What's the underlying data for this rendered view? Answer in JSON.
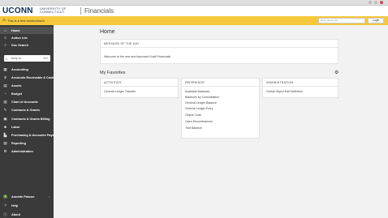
{
  "header": {
    "logo": "UCONN",
    "university": "UNIVERSITY OF CONNECTICUT",
    "app_title": "Financials"
  },
  "banner": {
    "message": "This is a test environment",
    "search_placeholder": "Basic (Enter ID)",
    "login_label": "Login"
  },
  "sidebar": {
    "top_items": [
      {
        "label": "Home",
        "icon": "home-icon"
      },
      {
        "label": "Action List",
        "icon": "list-icon"
      },
      {
        "label": "Doc Search",
        "icon": "search-icon"
      }
    ],
    "jump": {
      "label": "Jump to...",
      "go": "GO"
    },
    "items": [
      {
        "label": "Accounting",
        "icon": "calculator-icon"
      },
      {
        "label": "Accounts Receivable & Cash",
        "icon": "cash-icon"
      },
      {
        "label": "Assets",
        "icon": "building-icon"
      },
      {
        "label": "Budget",
        "icon": "budget-icon"
      },
      {
        "label": "Chart of Accounts",
        "icon": "chart-icon"
      },
      {
        "label": "Contracts & Grants",
        "icon": "contract-icon"
      },
      {
        "label": "Contracts & Grants Billing",
        "icon": "billing-icon"
      },
      {
        "label": "Labor",
        "icon": "labor-icon"
      },
      {
        "label": "Purchasing & Accounts Paya...",
        "icon": "cart-icon"
      },
      {
        "label": "Reporting",
        "icon": "report-icon"
      },
      {
        "label": "Administration",
        "icon": "gear-icon"
      }
    ],
    "bottom_items": [
      {
        "label": "Annette Pascoe",
        "icon": "user-icon"
      },
      {
        "label": "Help",
        "icon": "help-icon"
      },
      {
        "label": "About",
        "icon": "info-icon"
      }
    ]
  },
  "main": {
    "page_title": "Home",
    "motd": {
      "title": "MESSAGE OF THE DAY",
      "text": "Welcome to the new and improved Kuali Financials!"
    },
    "favorites_title": "My Favorites",
    "activities": {
      "title": "ACTIVITIES",
      "links": [
        "General Ledger Transfer"
      ]
    },
    "reference": {
      "title": "REFERENCE",
      "links": [
        "Available Balances",
        "Balances by Consolidation",
        "General Ledger Balance",
        "General Ledger Entry",
        "Object Code",
        "Open Encumbrances",
        "Trial Balance"
      ]
    },
    "administration": {
      "title": "ADMINISTRATION",
      "links": [
        "Global Object Edit Definition"
      ]
    }
  },
  "colors": {
    "banner": "#f5c73a",
    "sidebar": "#3a3a3a",
    "brand": "#0c2c55"
  }
}
